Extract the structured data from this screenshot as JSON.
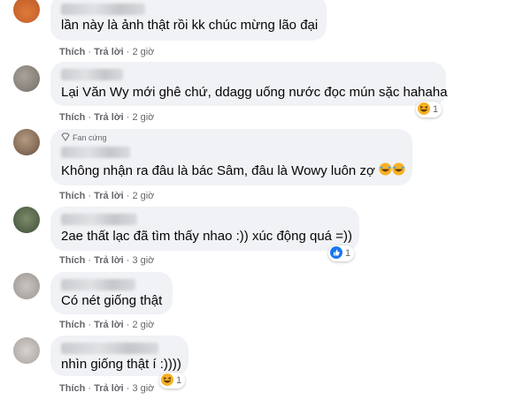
{
  "comments": [
    {
      "text": "lần này là ảnh thật rồi kk chúc mừng lão đại",
      "like_label": "Thích",
      "reply_label": "Trả lời",
      "time": "2 giờ"
    },
    {
      "text": "Lại Văn Wy mới ghê chứ, ddagg uống nước đọc mún sặc hahaha",
      "like_label": "Thích",
      "reply_label": "Trả lời",
      "time": "2 giờ",
      "reaction": {
        "icon": "haha-emoji-icon",
        "count": "1"
      }
    },
    {
      "badge": "Fan cứng",
      "text": "Không nhận ra đâu là bác Sâm, đâu là Wowy luôn zợ",
      "like_label": "Thích",
      "reply_label": "Trả lời",
      "time": "2 giờ"
    },
    {
      "text": "2ae thất lạc đã tìm thấy nhao :)) xúc động quá =))",
      "like_label": "Thích",
      "reply_label": "Trả lời",
      "time": "3 giờ",
      "reaction": {
        "icon": "like-icon",
        "count": "1"
      }
    },
    {
      "text": "Có nét giống thật",
      "like_label": "Thích",
      "reply_label": "Trả lời",
      "time": "2 giờ"
    },
    {
      "text": "nhìn giống thật í :))))",
      "like_label": "Thích",
      "reply_label": "Trả lời",
      "time": "3 giờ",
      "reaction": {
        "icon": "haha-emoji-icon",
        "count": "1"
      }
    }
  ],
  "colors": {
    "bubble": "#f0f2f5",
    "secondary_text": "#65676b",
    "like_blue": "#1877f2",
    "haha_yellow": "#f7b125"
  }
}
